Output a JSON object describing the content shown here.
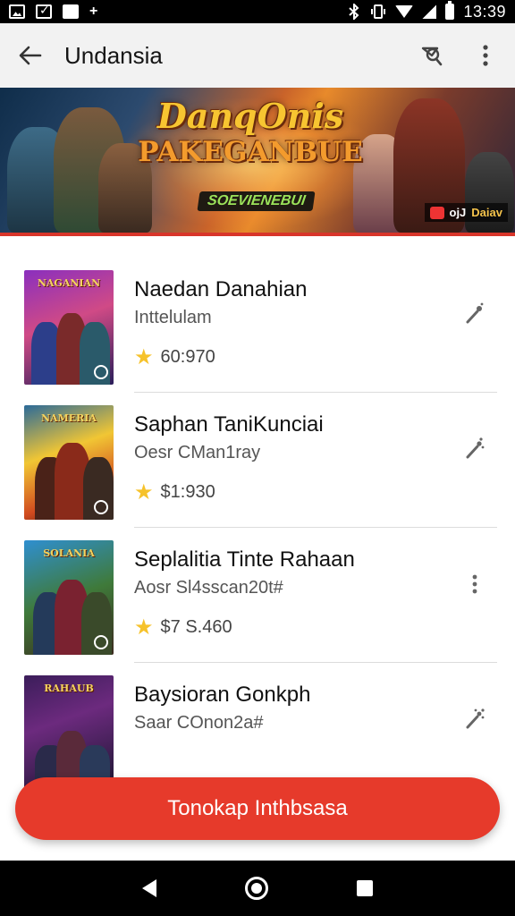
{
  "status_bar": {
    "time": "13:39"
  },
  "app_bar": {
    "title": "Undansia"
  },
  "banner": {
    "title_line1": "DanqOnis",
    "title_line2": "PAKEGANBUE",
    "tagline": "SOEVIENEBUI",
    "badge_text": "ojJ",
    "badge_sub": "Daiav"
  },
  "thumbnails": {
    "t1": "NAGANIAN",
    "t2": "NAMERIA",
    "t3": "SOLANIA",
    "t4": "RAHAUB"
  },
  "items": [
    {
      "title": "Naedan Danahian",
      "subtitle": "Inttelulam",
      "price": "60:970"
    },
    {
      "title": "Saphan TaniKunciai",
      "subtitle": "Oesr CMan1ray",
      "price": "$1:930"
    },
    {
      "title": "Seplalitia Tinte Rahaan",
      "subtitle": "Aosr Sl4sscan20t#",
      "price": "$7 S.460"
    },
    {
      "title": "Baysioran Gonkph",
      "subtitle": "Saar COnon2a#",
      "price": ""
    }
  ],
  "cta": {
    "label": "Tonokap Inthbsasa"
  },
  "colors": {
    "accent": "#e63a2b",
    "star": "#f6c22b"
  },
  "icons": {
    "back": "arrow-back-icon",
    "search": "search-icon",
    "menu": "more-vert-icon",
    "item_action": "magic-wand-icon",
    "star": "star-icon"
  }
}
